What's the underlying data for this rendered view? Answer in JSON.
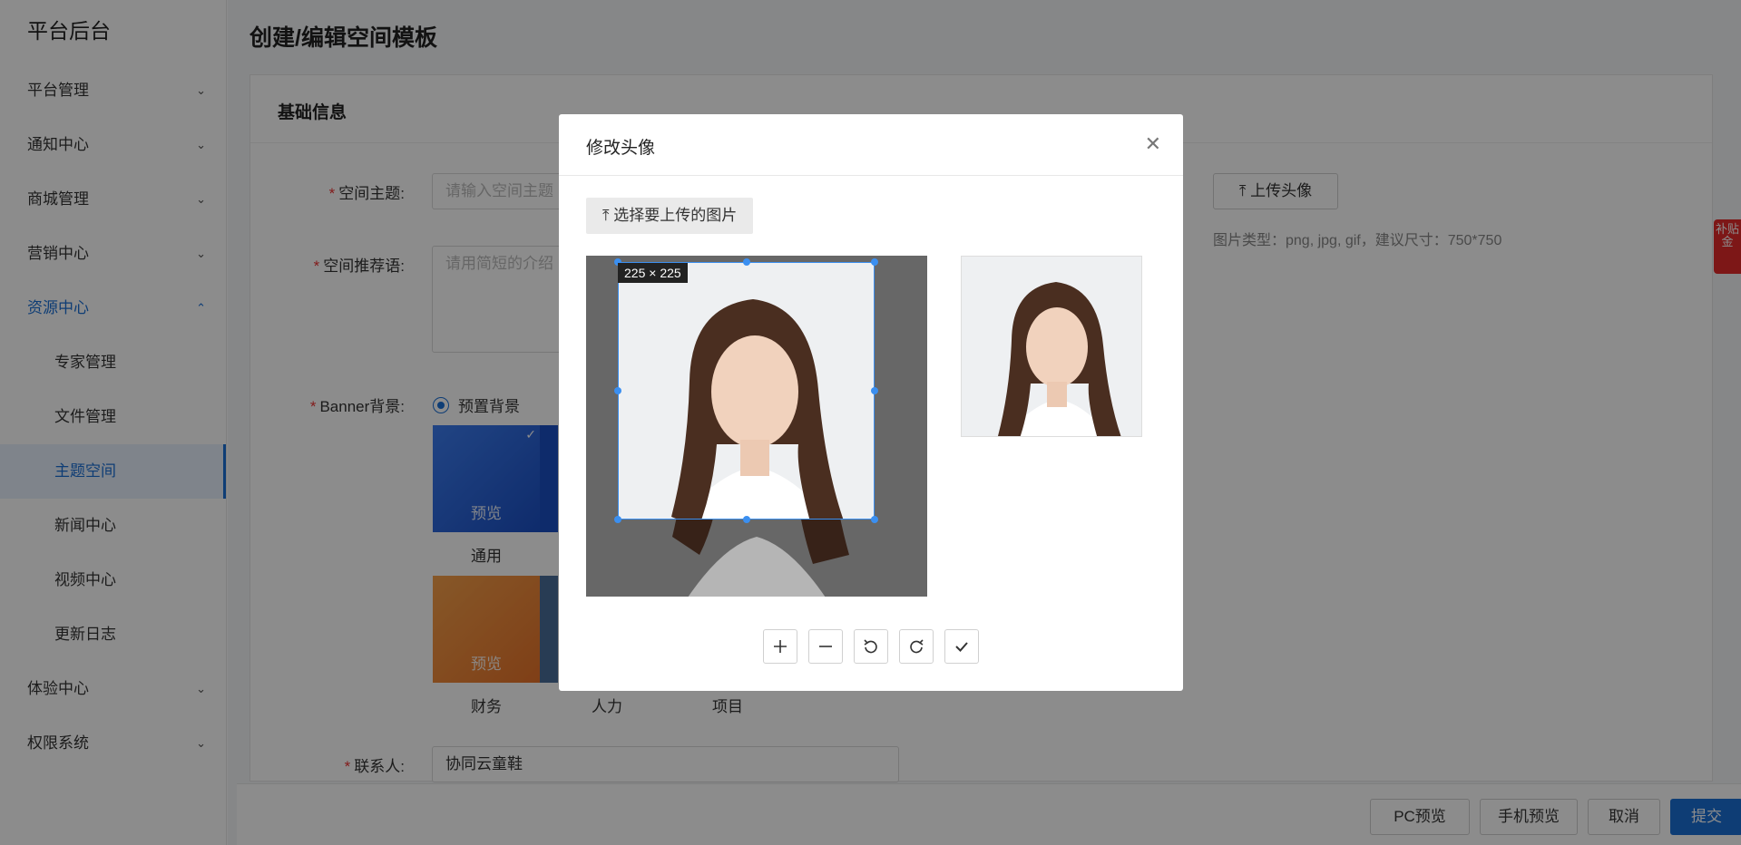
{
  "sidebar": {
    "brand": "平台后台",
    "menu": [
      {
        "label": "平台管理"
      },
      {
        "label": "通知中心"
      },
      {
        "label": "商城管理"
      },
      {
        "label": "营销中心"
      },
      {
        "label": "资源中心"
      }
    ],
    "sub_items": [
      {
        "label": "专家管理"
      },
      {
        "label": "文件管理"
      },
      {
        "label": "主题空间"
      },
      {
        "label": "新闻中心"
      },
      {
        "label": "视频中心"
      },
      {
        "label": "更新日志"
      }
    ],
    "menu_after": [
      {
        "label": "体验中心"
      },
      {
        "label": "权限系统"
      }
    ]
  },
  "page": {
    "title": "创建/编辑空间模板",
    "section_title": "基础信息",
    "fields": {
      "topic_label": "空间主题:",
      "topic_placeholder": "请输入空间主题",
      "slogan_label": "空间推荐语:",
      "slogan_placeholder": "请用简短的介绍",
      "banner_label": "Banner背景:",
      "banner_radio_preset": "预置背景",
      "contact_label": "联系人:",
      "contact_value": "协同云童鞋"
    },
    "thumbs": [
      {
        "overlay": "预览",
        "caption": "通用"
      },
      {
        "overlay": "预览",
        "caption": "财务"
      }
    ],
    "extra_captions": [
      "人力",
      "项目"
    ],
    "upload_avatar": "上传头像",
    "upload_hint": "图片类型：png, jpg, gif，建议尺寸：750*750",
    "footer_buttons": {
      "pc_preview": "PC预览",
      "mobile_preview": "手机预览",
      "cancel": "取消",
      "submit": "提交"
    },
    "side_badge": "补贴金"
  },
  "modal": {
    "title": "修改头像",
    "select_button": "选择要上传的图片",
    "crop_size": "225 × 225",
    "tools": [
      "zoom-in",
      "zoom-out",
      "rotate-left",
      "rotate-right",
      "confirm"
    ]
  },
  "colors": {
    "accent": "#1a6fd6",
    "required": "#e33333",
    "crop_border": "#3b8ff0"
  }
}
